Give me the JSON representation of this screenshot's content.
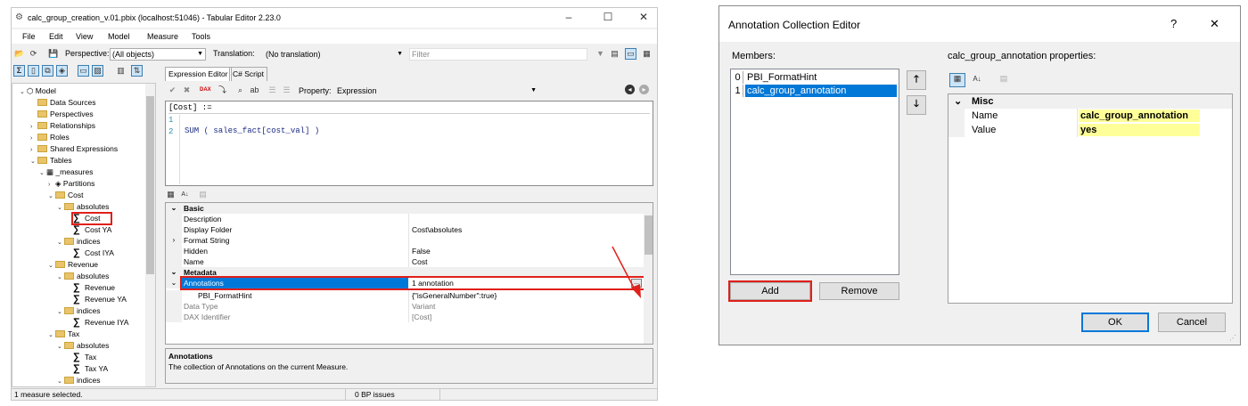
{
  "te": {
    "title": "calc_group_creation_v.01.pbix (localhost:51046) - Tabular Editor 2.23.0",
    "menu": [
      "File",
      "Edit",
      "View",
      "Model",
      "Measure",
      "Tools"
    ],
    "perspective_label": "Perspective:",
    "perspective_value": "(All objects)",
    "translation_label": "Translation:",
    "translation_value": "(No translation)",
    "filter_placeholder": "Filter",
    "tabs": [
      "Expression Editor",
      "C# Script"
    ],
    "property_label": "Property:",
    "property_value": "Expression",
    "code_header": "[Cost] :=",
    "code_lines": [
      "1",
      "2"
    ],
    "code_text": "SUM ( sales_fact[cost_val] )",
    "tree": [
      {
        "label": "Model",
        "icon": "model-icon"
      },
      {
        "label": "Data Sources",
        "icon": "folder-icon"
      },
      {
        "label": "Perspectives",
        "icon": "folder-icon"
      },
      {
        "label": "Relationships",
        "icon": "folder-icon"
      },
      {
        "label": "Roles",
        "icon": "folder-icon"
      },
      {
        "label": "Shared Expressions",
        "icon": "folder-icon"
      },
      {
        "label": "Tables",
        "icon": "folder-open-icon"
      },
      {
        "label": "_measures",
        "icon": "table-icon"
      },
      {
        "label": "Partitions",
        "icon": "partitions-icon"
      },
      {
        "label": "Cost",
        "icon": "folder-open-icon"
      },
      {
        "label": "absolutes",
        "icon": "folder-open-icon"
      },
      {
        "label": "Cost",
        "icon": "measure-icon"
      },
      {
        "label": "Cost YA",
        "icon": "measure-icon"
      },
      {
        "label": "indices",
        "icon": "folder-open-icon"
      },
      {
        "label": "Cost IYA",
        "icon": "measure-icon"
      },
      {
        "label": "Revenue",
        "icon": "folder-open-icon"
      },
      {
        "label": "absolutes",
        "icon": "folder-open-icon"
      },
      {
        "label": "Revenue",
        "icon": "measure-icon"
      },
      {
        "label": "Revenue YA",
        "icon": "measure-icon"
      },
      {
        "label": "indices",
        "icon": "folder-open-icon"
      },
      {
        "label": "Revenue IYA",
        "icon": "measure-icon"
      },
      {
        "label": "Tax",
        "icon": "folder-open-icon"
      },
      {
        "label": "absolutes",
        "icon": "folder-open-icon"
      },
      {
        "label": "Tax",
        "icon": "measure-icon"
      },
      {
        "label": "Tax YA",
        "icon": "measure-icon"
      },
      {
        "label": "indices",
        "icon": "folder-open-icon"
      }
    ],
    "props": {
      "cat_basic": "Basic",
      "description": "Description",
      "display_folder": "Display Folder",
      "display_folder_value": "Cost\\absolutes",
      "format_string": "Format String",
      "hidden": "Hidden",
      "hidden_value": "False",
      "name": "Name",
      "name_value": "Cost",
      "cat_metadata": "Metadata",
      "annotations": "Annotations",
      "annotations_value": "1 annotation",
      "pbi_formathint": "PBI_FormatHint",
      "pbi_formathint_value": "{\"isGeneralNumber\":true}",
      "data_type": "Data Type",
      "data_type_value": "Variant",
      "dax_identifier": "DAX Identifier",
      "dax_identifier_value": "[Cost]",
      "ellipsis": "..."
    },
    "desc_title": "Annotations",
    "desc_text": "The collection of Annotations on the current Measure.",
    "status_left": "1 measure selected.",
    "status_mid": "0 BP issues"
  },
  "dlg": {
    "title": "Annotation Collection Editor",
    "help": "?",
    "close": "✕",
    "members_label": "Members:",
    "members": [
      {
        "index": "0",
        "name": "PBI_FormatHint"
      },
      {
        "index": "1",
        "name": "calc_group_annotation"
      }
    ],
    "props_label": "calc_group_annotation properties:",
    "cat_misc": "Misc",
    "name_label": "Name",
    "name_value": "calc_group_annotation",
    "value_label": "Value",
    "value_value": "yes",
    "add": "Add",
    "remove": "Remove",
    "ok": "OK",
    "cancel": "Cancel"
  },
  "colors": {
    "selection": "#0078d7",
    "highlight": "#ffff99",
    "annotation_box": "#e0201a"
  }
}
